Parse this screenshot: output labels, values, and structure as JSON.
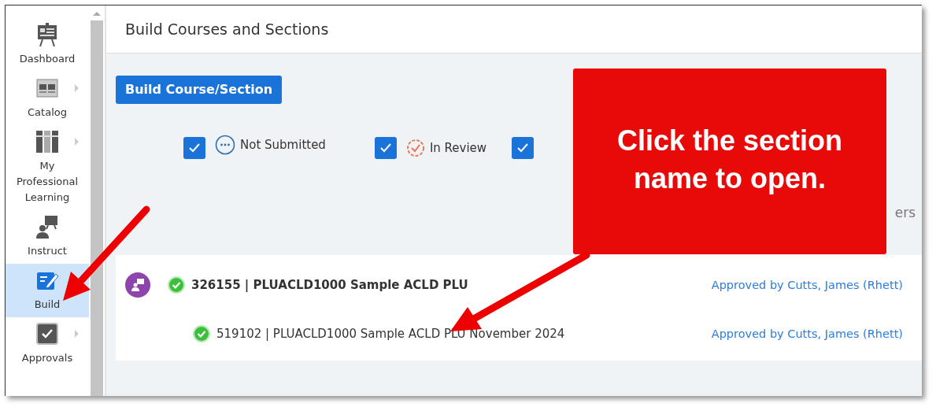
{
  "sidebar": {
    "items": [
      {
        "kind": "dashboard",
        "label": "Dashboard",
        "selected": false,
        "submenu": false
      },
      {
        "kind": "catalog",
        "label": "Catalog",
        "selected": false,
        "submenu": true
      },
      {
        "kind": "books",
        "label": "My Professional Learning",
        "selected": false,
        "submenu": true
      },
      {
        "kind": "instruct",
        "label": "Instruct",
        "selected": false,
        "submenu": false
      },
      {
        "kind": "build",
        "label": "Build",
        "selected": true,
        "submenu": false
      },
      {
        "kind": "approvals",
        "label": "Approvals",
        "selected": false,
        "submenu": true
      }
    ]
  },
  "header": {
    "title": "Build Courses and Sections"
  },
  "build_button": "Build Course/Section",
  "filters": [
    {
      "kind": "not_submitted",
      "label": "Not Submitted",
      "checked": true
    },
    {
      "kind": "in_review",
      "label": "In Review",
      "checked": true
    },
    {
      "checked": true
    }
  ],
  "partial_label": "ers",
  "rows": [
    {
      "kind": "course",
      "title": "326155 | PLUACLD1000 Sample ACLD PLU",
      "approval": "Approved by Cutts, James (Rhett)"
    },
    {
      "kind": "section",
      "title": "519102 | PLUACLD1000 Sample ACLD PLU November 2024",
      "approval": "Approved by Cutts, James (Rhett)"
    }
  ],
  "callout": {
    "text": "Click the section name to open."
  }
}
